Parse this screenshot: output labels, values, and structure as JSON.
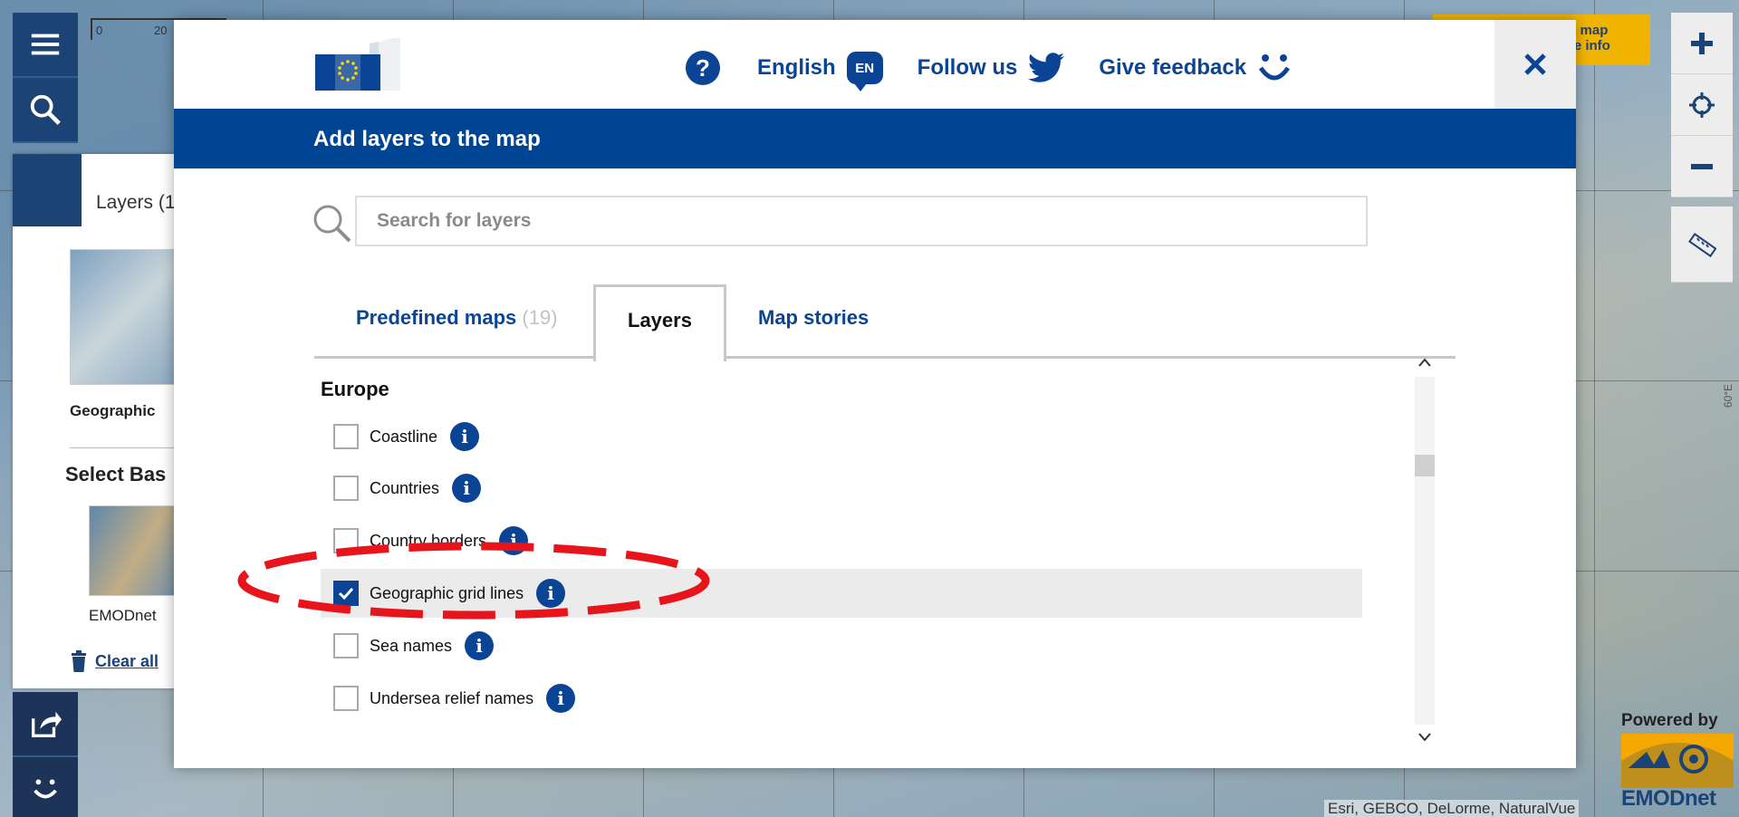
{
  "map": {
    "scale_labels": [
      "0",
      "20"
    ],
    "coord_label": "60°E",
    "attribution": "Esri, GEBCO, DeLorme, NaturalVue",
    "powered_by": "Powered by",
    "emodnet_brand": "EMODnet",
    "info_badge_line1": "e map",
    "info_badge_line2": "re info"
  },
  "left_panel": {
    "tab_label": "Layers (1",
    "layer_caption": "Geographic",
    "select_base": "Select Bas",
    "base_caption": "EMODnet",
    "clear_all": "Clear all"
  },
  "modal": {
    "topbar": {
      "language_label": "English",
      "language_code": "EN",
      "follow_label": "Follow us",
      "feedback_label": "Give feedback",
      "help_glyph": "?"
    },
    "title": "Add layers to the map",
    "search": {
      "placeholder": "Search for layers",
      "value": ""
    },
    "tabs": [
      {
        "label": "Predefined maps",
        "count": "(19)",
        "active": false
      },
      {
        "label": "Layers",
        "count": "",
        "active": true
      },
      {
        "label": "Map stories",
        "count": "",
        "active": false
      }
    ],
    "group_title": "Europe",
    "layers": [
      {
        "label": "Coastline",
        "checked": false
      },
      {
        "label": "Countries",
        "checked": false
      },
      {
        "label": "Country borders",
        "checked": false
      },
      {
        "label": "Geographic grid lines",
        "checked": true
      },
      {
        "label": "Sea names",
        "checked": false
      },
      {
        "label": "Undersea relief names",
        "checked": false
      }
    ],
    "info_glyph": "i"
  },
  "colors": {
    "brand_blue": "#004494",
    "link_blue": "#0b4494",
    "highlight_red": "#e8141c",
    "accent_yellow": "#f0b400"
  }
}
